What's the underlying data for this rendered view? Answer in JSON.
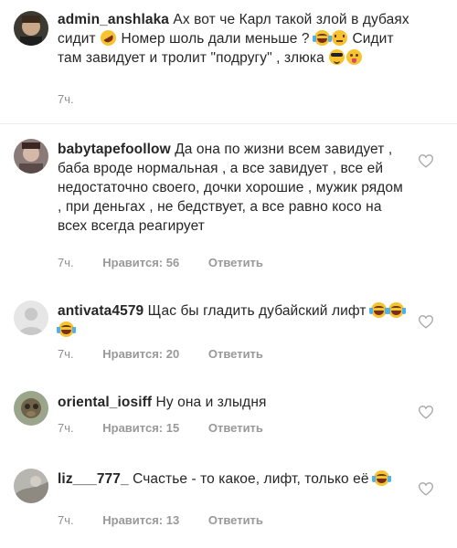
{
  "comments": [
    {
      "username": "admin_anshlaka",
      "segments": [
        {
          "type": "text",
          "value": " Ах вот че Карл такой злой в дубаях сидит "
        },
        {
          "type": "emoji",
          "name": "rofl-emoji"
        },
        {
          "type": "text",
          "value": " Номер шоль  дали меньше ? "
        },
        {
          "type": "emoji",
          "name": "laugh-cry-emoji"
        },
        {
          "type": "emoji",
          "name": "squint-emoji"
        },
        {
          "type": "text",
          "value": " Сидит там завидует и тролит \"подругу\" , злюка "
        },
        {
          "type": "emoji",
          "name": "sunglasses-emoji"
        },
        {
          "type": "emoji",
          "name": "wink-tongue-emoji"
        }
      ],
      "time": "7ч.",
      "likes": "",
      "reply": "",
      "has_heart": false
    },
    {
      "username": "babytapefoollow",
      "segments": [
        {
          "type": "text",
          "value": " Да она по жизни всем завидует , баба вроде нормальная , а все завидует , все ей недостаточно своего, дочки хорошие , мужик рядом , при деньгах , не бедствует, а все равно косо на всех всегда реагирует"
        }
      ],
      "time": "7ч.",
      "likes": "Нравится: 56",
      "reply": "Ответить",
      "has_heart": true
    },
    {
      "username": "antivata4579",
      "segments": [
        {
          "type": "text",
          "value": " Щас бы гладить дубайский лифт "
        },
        {
          "type": "emoji",
          "name": "laugh-cry-emoji"
        },
        {
          "type": "emoji",
          "name": "laugh-cry-emoji"
        },
        {
          "type": "emoji",
          "name": "laugh-cry-emoji"
        }
      ],
      "time": "7ч.",
      "likes": "Нравится: 20",
      "reply": "Ответить",
      "has_heart": true
    },
    {
      "username": "oriental_iosiff",
      "segments": [
        {
          "type": "text",
          "value": " Ну она и злыдня"
        }
      ],
      "time": "7ч.",
      "likes": "Нравится: 15",
      "reply": "Ответить",
      "has_heart": true
    },
    {
      "username": "liz___777_",
      "segments": [
        {
          "type": "text",
          "value": " Счастье - то какое, лифт, только её "
        },
        {
          "type": "emoji",
          "name": "laugh-cry-emoji"
        }
      ],
      "time": "7ч.",
      "likes": "Нравится: 13",
      "reply": "Ответить",
      "has_heart": true
    }
  ],
  "colors": {
    "text": "#262626",
    "meta": "#8e8e8e",
    "divider": "#ececec",
    "heart": "#a8a8a8"
  }
}
